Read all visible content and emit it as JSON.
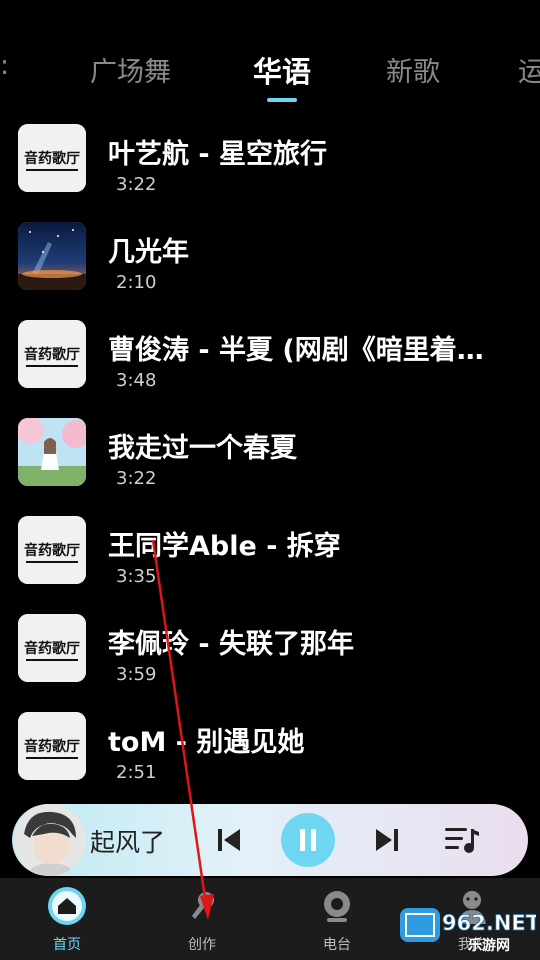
{
  "tabs": {
    "items": [
      "广场舞",
      "华语",
      "新歌",
      "运"
    ],
    "active": "华语"
  },
  "songs": [
    {
      "title": "叶艺航 - 星空旅行",
      "duration": "3:22",
      "cover": "brand-logo"
    },
    {
      "title": "几光年",
      "duration": "2:10",
      "cover": "starry-sky"
    },
    {
      "title": "曹俊涛 - 半夏 (网剧《暗里着…",
      "duration": "3:48",
      "cover": "brand-logo"
    },
    {
      "title": "我走过一个春夏",
      "duration": "3:22",
      "cover": "anime-girl"
    },
    {
      "title": "王同学Able - 拆穿",
      "duration": "3:35",
      "cover": "brand-logo"
    },
    {
      "title": "李佩玲 - 失联了那年",
      "duration": "3:59",
      "cover": "brand-logo"
    },
    {
      "title": "toM - 别遇见她",
      "duration": "2:51",
      "cover": "brand-logo"
    }
  ],
  "cover_logo_text": "音药歌厅",
  "player": {
    "title": "起风了",
    "controls": [
      "previous-icon",
      "pause-icon",
      "next-icon",
      "playlist-icon"
    ],
    "accent": "#6fd6f2"
  },
  "bottom_nav": [
    {
      "label": "首页",
      "icon": "home-icon",
      "active": true
    },
    {
      "label": "创作",
      "icon": "mic-icon",
      "active": false
    },
    {
      "label": "电台",
      "icon": "radio-icon",
      "active": false
    },
    {
      "label": "我的",
      "icon": "profile-icon",
      "active": false
    }
  ],
  "watermark": {
    "text": "962.NET",
    "sub": "乐游网"
  }
}
